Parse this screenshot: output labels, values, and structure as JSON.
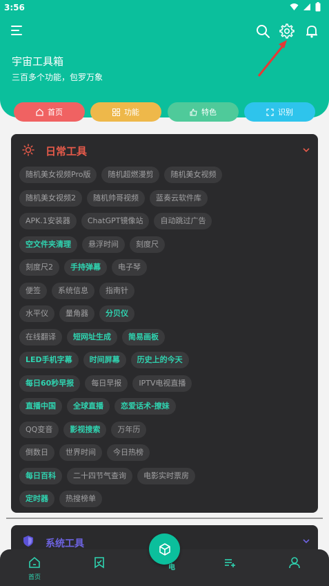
{
  "status_bar": {
    "time": "3:56"
  },
  "header": {
    "title": "宇宙工具箱",
    "subtitle": "三百多个功能，包罗万象"
  },
  "nav_tabs": [
    {
      "label": "首页",
      "color": "#f06262"
    },
    {
      "label": "功能",
      "color": "#eeb84a"
    },
    {
      "label": "特色",
      "color": "#4fca9a"
    },
    {
      "label": "识别",
      "color": "#2ec4ec"
    }
  ],
  "daily_tools": {
    "title": "日常工具",
    "rows": [
      [
        {
          "label": "随机美女视频Pro版",
          "hl": false
        },
        {
          "label": "随机超燃漫剪",
          "hl": false
        },
        {
          "label": "随机美女视频",
          "hl": false
        }
      ],
      [
        {
          "label": "随机美女视频2",
          "hl": false
        },
        {
          "label": "随机帅哥视频",
          "hl": false
        },
        {
          "label": "蓝奏云软件库",
          "hl": false
        }
      ],
      [
        {
          "label": "APK.1安装器",
          "hl": false
        },
        {
          "label": "ChatGPT镜像站",
          "hl": false
        },
        {
          "label": "自动跳过广告",
          "hl": false
        }
      ],
      [
        {
          "label": "空文件夹清理",
          "hl": true
        },
        {
          "label": "悬浮时间",
          "hl": false
        },
        {
          "label": "刻度尺",
          "hl": false
        }
      ],
      [
        {
          "label": "刻度尺2",
          "hl": false
        },
        {
          "label": "手持弹幕",
          "hl": true
        },
        {
          "label": "电子琴",
          "hl": false
        }
      ],
      [
        {
          "label": "便签",
          "hl": false
        },
        {
          "label": "系统信息",
          "hl": false
        },
        {
          "label": "指南针",
          "hl": false
        }
      ],
      [
        {
          "label": "水平仪",
          "hl": false
        },
        {
          "label": "量角器",
          "hl": false
        },
        {
          "label": "分贝仪",
          "hl": true
        }
      ],
      [
        {
          "label": "在线翻译",
          "hl": false
        },
        {
          "label": "短网址生成",
          "hl": true
        },
        {
          "label": "简易画板",
          "hl": true
        }
      ],
      [
        {
          "label": "LED手机字幕",
          "hl": true
        },
        {
          "label": "时间屏幕",
          "hl": true
        },
        {
          "label": "历史上的今天",
          "hl": true
        }
      ],
      [
        {
          "label": "每日60秒早报",
          "hl": true
        },
        {
          "label": "每日早报",
          "hl": false
        },
        {
          "label": "IPTV电视直播",
          "hl": false
        }
      ],
      [
        {
          "label": "直播中国",
          "hl": true
        },
        {
          "label": "全球直播",
          "hl": true
        },
        {
          "label": "恋爱话术-撩妹",
          "hl": true
        }
      ],
      [
        {
          "label": "QQ变音",
          "hl": false
        },
        {
          "label": "影视搜索",
          "hl": true
        },
        {
          "label": "万年历",
          "hl": false
        }
      ],
      [
        {
          "label": "倒数日",
          "hl": false
        },
        {
          "label": "世界时间",
          "hl": false
        },
        {
          "label": "今日热榜",
          "hl": false
        }
      ],
      [
        {
          "label": "每日百科",
          "hl": true
        },
        {
          "label": "二十四节气查询",
          "hl": false
        },
        {
          "label": "电影实时票房",
          "hl": false
        }
      ],
      [
        {
          "label": "定时器",
          "hl": true
        },
        {
          "label": "热搜榜单",
          "hl": false
        }
      ]
    ]
  },
  "system_tools": {
    "title": "系统工具"
  },
  "bottom_nav": {
    "home_label": "首页",
    "fab_partial": "电"
  }
}
